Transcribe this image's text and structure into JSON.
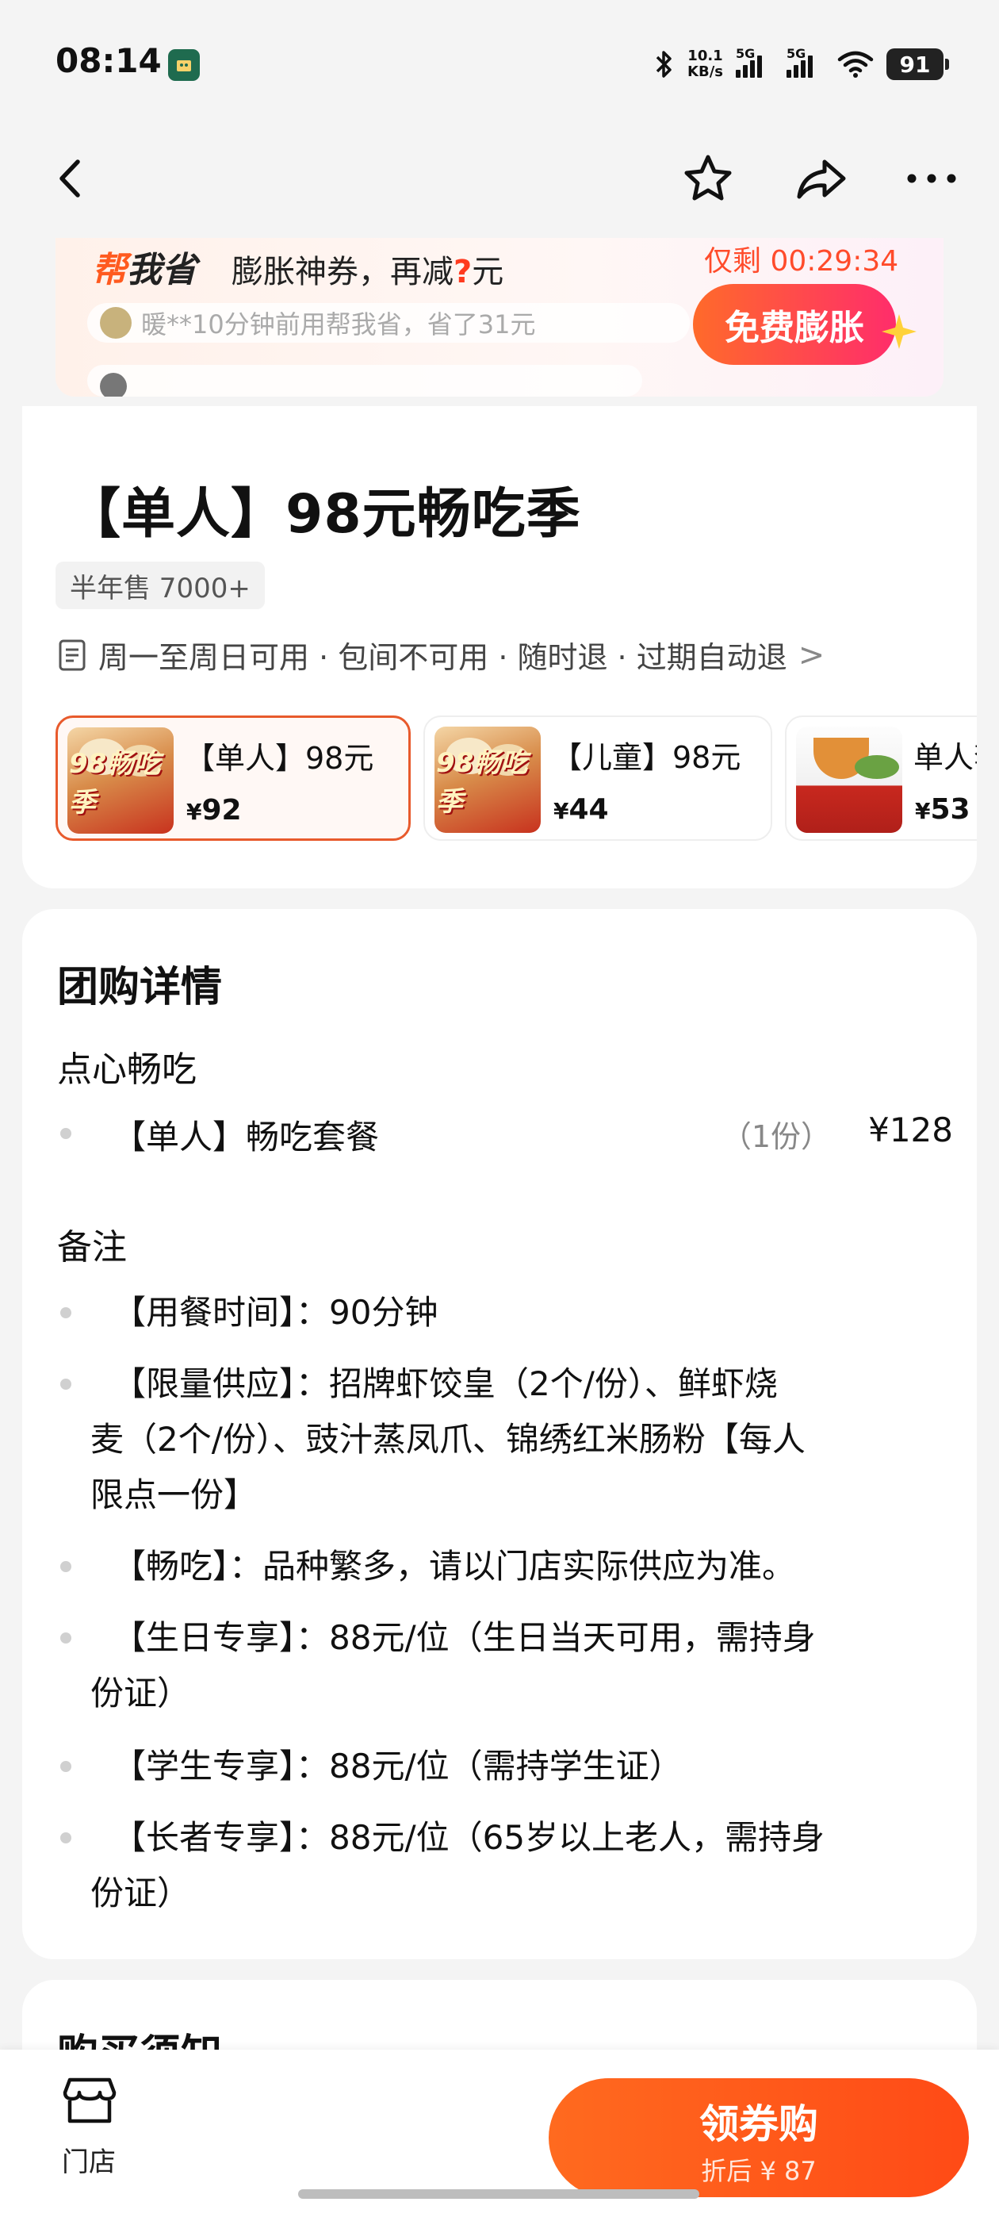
{
  "status_bar": {
    "time": "08:14",
    "net_speed_value": "10.1",
    "net_speed_unit": "KB/s",
    "signal1_label": "5G",
    "signal2_label": "5G",
    "battery": "91",
    "icons": [
      "bluetooth-icon",
      "signal-icon",
      "signal-icon",
      "wifi-icon",
      "battery-icon"
    ]
  },
  "nav": {
    "icons": [
      "back-icon",
      "star-icon",
      "share-icon",
      "more-icon"
    ]
  },
  "coupon_banner": {
    "brand_part1": "帮",
    "brand_part2": "我省",
    "title_prefix": "膨胀神券，再减",
    "title_mystery": "?",
    "title_suffix": "元",
    "countdown": "仅剩 00:29:34",
    "ticker_text": "暖**10分钟前用帮我省，省了31元",
    "button_label": "免费膨胀",
    "colors": {
      "brand": "#ff5a1f",
      "button_start": "#ff6a2a",
      "button_end": "#ff2d6b",
      "countdown": "#ff4b2b"
    }
  },
  "product": {
    "title": "【单人】98元畅吃季",
    "sales": "半年售 7000+",
    "usage": "周一至周日可用 · 包间不可用 · 随时退 · 过期自动退",
    "usage_chevron": ">",
    "badge_text": "98畅吃季",
    "variants": [
      {
        "name": "【单人】98元",
        "currency": "¥",
        "price": "92",
        "selected": true
      },
      {
        "name": "【儿童】98元",
        "currency": "¥",
        "price": "44",
        "selected": false
      },
      {
        "name": "单人套",
        "currency": "¥",
        "price": "53",
        "selected": false
      }
    ]
  },
  "details": {
    "title": "团购详情",
    "section1_title": "点心畅吃",
    "items": [
      {
        "name": "【单人】畅吃套餐",
        "qty": "（1份）",
        "price": "¥128"
      }
    ],
    "section2_title": "备注",
    "notes": [
      {
        "line1": "【用餐时间】：90分钟",
        "line2": "",
        "line3": ""
      },
      {
        "line1": "【限量供应】：招牌虾饺皇（2个/份）、鲜虾烧",
        "line2": "麦（2个/份）、豉汁蒸凤爪、锦绣红米肠粉【每人",
        "line3": "限点一份】"
      },
      {
        "line1": "【畅吃】：品种繁多，请以门店实际供应为准。",
        "line2": "",
        "line3": ""
      },
      {
        "line1": "【生日专享】：88元/位（生日当天可用，需持身",
        "line2": "份证）",
        "line3": ""
      },
      {
        "line1": "【学生专享】：88元/位（需持学生证）",
        "line2": "",
        "line3": ""
      },
      {
        "line1": "【长者专享】：88元/位（65岁以上老人，需持身",
        "line2": "份证）",
        "line3": ""
      }
    ]
  },
  "notice": {
    "title": "购买须知"
  },
  "bottom_bar": {
    "store_label": "门店",
    "buy_label": "领券购",
    "buy_sub": "折后 ¥ 87",
    "accent": "#ff5a1f"
  }
}
